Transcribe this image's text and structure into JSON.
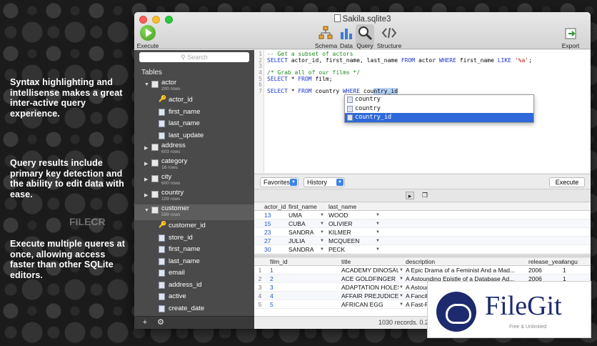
{
  "promo": [
    "Syntax highlighting and intellisense makes a great inter-active query experience.",
    "Query results include primary key detection and the ability to edit data with ease.",
    "Execute multiple queres at once, allowing access faster than other SQLite editors."
  ],
  "window": {
    "title": "Sakila.sqlite3"
  },
  "toolbar": {
    "execute": "Execute",
    "schema": "Schema",
    "data": "Data",
    "query": "Query",
    "structure": "Structure",
    "export": "Export"
  },
  "sidebar": {
    "search_placeholder": "Search",
    "tables_header": "Tables",
    "tree": [
      {
        "kind": "table",
        "name": "actor",
        "count": "200 rows",
        "expanded": true
      },
      {
        "kind": "col",
        "name": "actor_id",
        "key": true
      },
      {
        "kind": "col",
        "name": "first_name"
      },
      {
        "kind": "col",
        "name": "last_name"
      },
      {
        "kind": "col",
        "name": "last_update"
      },
      {
        "kind": "table",
        "name": "address",
        "count": "603 rows"
      },
      {
        "kind": "table",
        "name": "category",
        "count": "16 rows"
      },
      {
        "kind": "table",
        "name": "city",
        "count": "600 rows"
      },
      {
        "kind": "table",
        "name": "country",
        "count": "109 rows"
      },
      {
        "kind": "table",
        "name": "customer",
        "count": "599 rows",
        "expanded": true,
        "selected": true
      },
      {
        "kind": "col",
        "name": "customer_id",
        "key": true
      },
      {
        "kind": "col",
        "name": "store_id"
      },
      {
        "kind": "col",
        "name": "first_name"
      },
      {
        "kind": "col",
        "name": "last_name"
      },
      {
        "kind": "col",
        "name": "email"
      },
      {
        "kind": "col",
        "name": "address_id"
      },
      {
        "kind": "col",
        "name": "active"
      },
      {
        "kind": "col",
        "name": "create_date"
      }
    ]
  },
  "editor": {
    "line_numbers": [
      "1",
      "2",
      "3",
      "4",
      "5",
      "6",
      "7"
    ],
    "lines": [
      [
        {
          "t": "-- Get a subset of actors",
          "c": "c-comment"
        }
      ],
      [
        {
          "t": "SELECT",
          "c": "c-kw"
        },
        {
          "t": " actor_id, first_name, last_name "
        },
        {
          "t": "FROM",
          "c": "c-kw"
        },
        {
          "t": " actor "
        },
        {
          "t": "WHERE",
          "c": "c-kw"
        },
        {
          "t": " first_name "
        },
        {
          "t": "LIKE",
          "c": "c-kw"
        },
        {
          "t": " "
        },
        {
          "t": "'%a'",
          "c": "c-str"
        },
        {
          "t": ";"
        }
      ],
      [
        {
          "t": ""
        }
      ],
      [
        {
          "t": "/* Grab all of our films */",
          "c": "c-comment"
        }
      ],
      [
        {
          "t": "SELECT",
          "c": "c-kw"
        },
        {
          "t": " * "
        },
        {
          "t": "FROM",
          "c": "c-kw"
        },
        {
          "t": " film;"
        }
      ],
      [
        {
          "t": ""
        }
      ],
      [
        {
          "t": "SELECT",
          "c": "c-kw"
        },
        {
          "t": " * "
        },
        {
          "t": "FROM",
          "c": "c-kw"
        },
        {
          "t": " country "
        },
        {
          "t": "WHERE",
          "c": "c-kw"
        },
        {
          "t": " cou"
        },
        {
          "t": "ntry_id",
          "c": "c-sel"
        }
      ]
    ],
    "autocomplete": [
      "country",
      "country",
      "country_id"
    ]
  },
  "query_bar": {
    "favorites": "Favorites",
    "history": "History",
    "execute": "Execute"
  },
  "results1": {
    "columns": [
      "actor_id",
      "first_name",
      "last_name"
    ],
    "rows": [
      [
        "13",
        "UMA",
        "WOOD"
      ],
      [
        "15",
        "CUBA",
        "OLIVIER"
      ],
      [
        "23",
        "SANDRA",
        "KILMER"
      ],
      [
        "27",
        "JULIA",
        "MCQUEEN"
      ],
      [
        "30",
        "SANDRA",
        "PECK"
      ]
    ]
  },
  "results2": {
    "columns": [
      "film_id",
      "title",
      "description",
      "release_year",
      "langu"
    ],
    "rows": [
      [
        "1",
        "1",
        "ACADEMY DINOSAUR",
        "A Epic Drama of a Feminist And a Mad...",
        "2006",
        "1"
      ],
      [
        "2",
        "2",
        "ACE GOLDFINGER",
        "A Astounding Epistle of a Database Ad...",
        "2006",
        "1"
      ],
      [
        "3",
        "3",
        "ADAPTATION HOLES",
        "A Astoun",
        "",
        ""
      ],
      [
        "4",
        "4",
        "AFFAIR PREJUDICE",
        "A Fancifu",
        "",
        ""
      ],
      [
        "5",
        "5",
        "AFRICAN EGG",
        "A Fast-Pa",
        "",
        ""
      ]
    ]
  },
  "status": "1030 records. 0.22",
  "watermark": "FILECR",
  "logo": {
    "name": "FileGit",
    "tagline": "Free & Unlimited"
  }
}
